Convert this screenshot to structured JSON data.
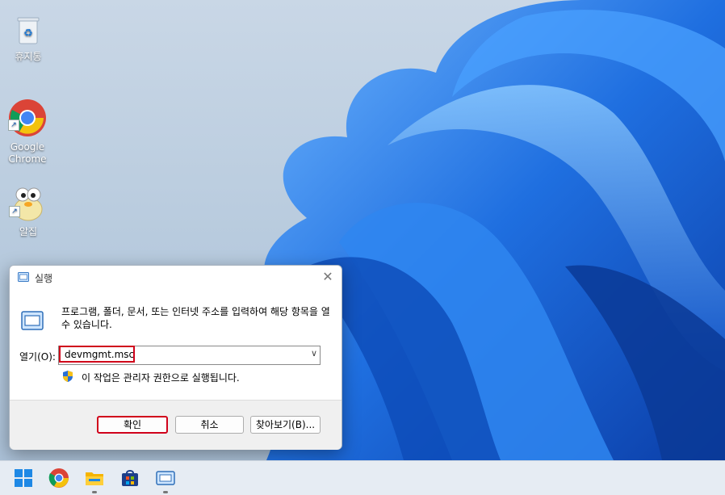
{
  "desktop": {
    "icons": [
      {
        "label": "휴지통"
      },
      {
        "label": "Google\nChrome"
      },
      {
        "label": "알집"
      }
    ]
  },
  "run_dialog": {
    "title": "실행",
    "description": "프로그램, 폴더, 문서, 또는 인터넷 주소를 입력하여 해당 항목을 열 수 있습니다.",
    "open_label": "열기(O):",
    "open_value": "devmgmt.msc",
    "admin_note": "이 작업은 관리자 권한으로 실행됩니다.",
    "ok_label": "확인",
    "cancel_label": "취소",
    "browse_label": "찾아보기(B)..."
  },
  "taskbar": {
    "items": [
      "start-icon",
      "chrome-icon",
      "file-explorer-icon",
      "store-icon",
      "run-icon"
    ]
  },
  "colors": {
    "highlight": "#d0021b",
    "accent": "#1a73e8"
  }
}
